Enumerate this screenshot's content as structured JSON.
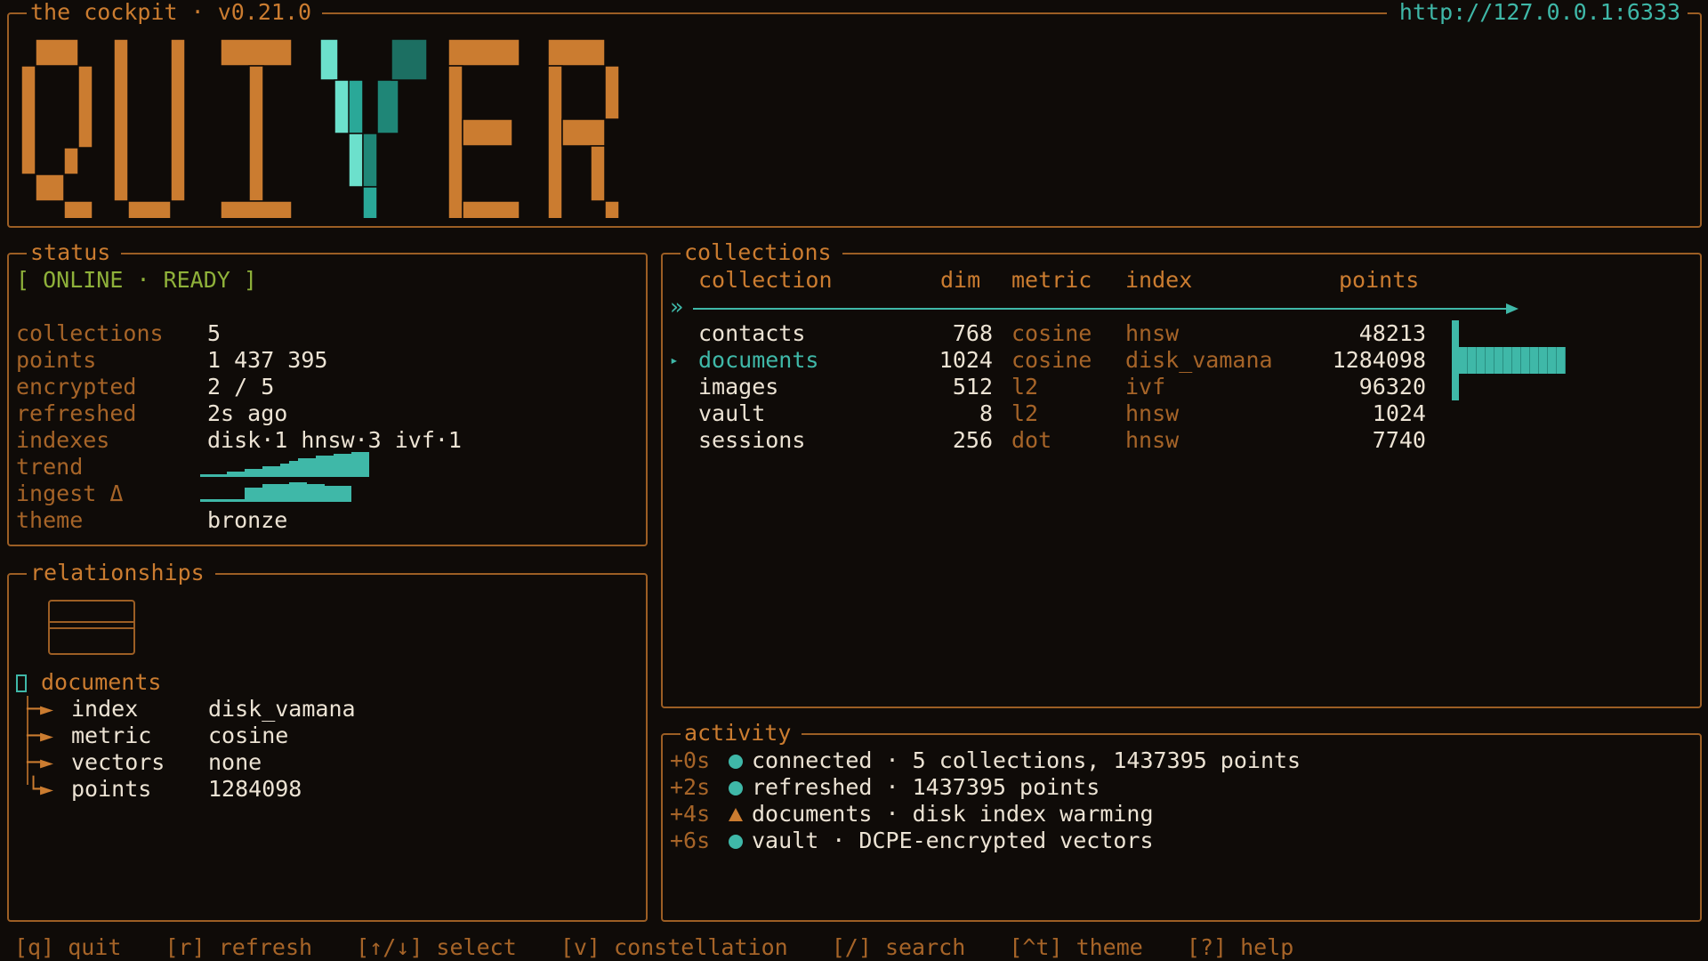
{
  "header": {
    "title": "the cockpit · v0.21.0",
    "url": "http://127.0.0.1:6333",
    "logo_text": "QUIVER"
  },
  "status": {
    "title": "status",
    "state": "[ ONLINE · READY ]",
    "rows": [
      {
        "key": "collections",
        "value": "5"
      },
      {
        "key": "points",
        "value": "1 437 395"
      },
      {
        "key": "encrypted",
        "value": "2 / 5"
      },
      {
        "key": "refreshed",
        "value": "2s ago"
      },
      {
        "key": "indexes",
        "value": "disk·1 hnsw·3 ivf·1"
      },
      {
        "key": "trend",
        "value": ""
      },
      {
        "key": "ingest Δ",
        "value": ""
      },
      {
        "key": "theme",
        "value": "bronze"
      }
    ]
  },
  "collections": {
    "title": "collections",
    "headers": {
      "collection": "collection",
      "dim": "dim",
      "metric": "metric",
      "index": "index",
      "points": "points"
    },
    "rows": [
      {
        "collection": "contacts",
        "dim": "768",
        "metric": "cosine",
        "index": "hnsw",
        "points": "48213",
        "selected": false
      },
      {
        "collection": "documents",
        "dim": "1024",
        "metric": "cosine",
        "index": "disk_vamana",
        "points": "1284098",
        "selected": true
      },
      {
        "collection": "images",
        "dim": "512",
        "metric": "l2",
        "index": "ivf",
        "points": "96320",
        "selected": false
      },
      {
        "collection": "vault",
        "dim": "8",
        "metric": "l2",
        "index": "hnsw",
        "points": "1024",
        "selected": false
      },
      {
        "collection": "sessions",
        "dim": "256",
        "metric": "dot",
        "index": "hnsw",
        "points": "7740",
        "selected": false
      }
    ],
    "scroll_prefix": "»"
  },
  "relationships": {
    "title": "relationships",
    "root": "documents",
    "children": [
      {
        "key": "index",
        "value": "disk_vamana"
      },
      {
        "key": "metric",
        "value": "cosine"
      },
      {
        "key": "vectors",
        "value": "none"
      },
      {
        "key": "points",
        "value": "1284098"
      }
    ]
  },
  "activity": {
    "title": "activity",
    "events": [
      {
        "time": "+0s",
        "level": "ok",
        "text": "connected · 5 collections, 1437395 points"
      },
      {
        "time": "+2s",
        "level": "ok",
        "text": "refreshed · 1437395 points"
      },
      {
        "time": "+4s",
        "level": "warn",
        "text": "documents · disk index warming"
      },
      {
        "time": "+6s",
        "level": "ok",
        "text": "vault · DCPE-encrypted vectors"
      }
    ]
  },
  "footer": {
    "keys": [
      "[q] quit",
      "[r] refresh",
      "[↑/↓] select",
      "[v] constellation",
      "[/] search",
      "[^t] theme",
      "[?] help"
    ]
  },
  "colors": {
    "accent": "#cb7c30",
    "teal": "#3fb8a8",
    "online": "#8fb13a",
    "background": "#0f0b08"
  }
}
